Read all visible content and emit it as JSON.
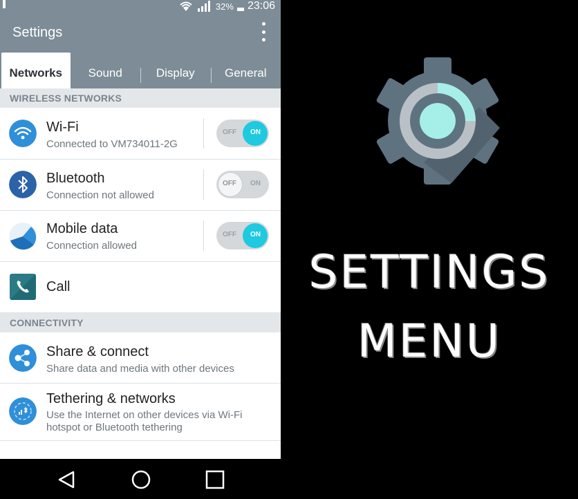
{
  "status_bar": {
    "battery": "32%",
    "time": "23:06"
  },
  "app": {
    "title": "Settings"
  },
  "tabs": [
    {
      "label": "Networks",
      "active": true
    },
    {
      "label": "Sound",
      "active": false
    },
    {
      "label": "Display",
      "active": false
    },
    {
      "label": "General",
      "active": false
    }
  ],
  "sections": {
    "wireless": "WIRELESS NETWORKS",
    "connectivity": "CONNECTIVITY"
  },
  "items": {
    "wifi": {
      "title": "Wi-Fi",
      "subtitle": "Connected to VM734011-2G",
      "toggle": "on",
      "off_label": "OFF",
      "on_label": "ON"
    },
    "bluetooth": {
      "title": "Bluetooth",
      "subtitle": "Connection not allowed",
      "toggle": "off",
      "off_label": "OFF",
      "on_label": "ON"
    },
    "mobile_data": {
      "title": "Mobile data",
      "subtitle": "Connection allowed",
      "toggle": "on",
      "off_label": "OFF",
      "on_label": "ON"
    },
    "call": {
      "title": "Call"
    },
    "share": {
      "title": "Share & connect",
      "subtitle": "Share data and media with other devices"
    },
    "tethering": {
      "title": "Tethering & networks",
      "subtitle_line1": "Use the Internet on other devices via Wi-Fi",
      "subtitle_line2": "hotspot or Bluetooth tethering"
    }
  },
  "promo": {
    "line1": "SETTINGS",
    "line2": "MENU"
  },
  "colors": {
    "accent": "#1fc9df",
    "appbar": "#7d8c96",
    "gear": "#5f7280",
    "gear_ring": "#b9c1c6",
    "gear_center": "#a5efe8"
  },
  "icons": [
    "wifi-icon",
    "bluetooth-icon",
    "mobile-data-icon",
    "call-icon",
    "share-icon",
    "tethering-icon",
    "back-icon",
    "home-icon",
    "recents-icon",
    "gear-icon",
    "more-icon"
  ]
}
